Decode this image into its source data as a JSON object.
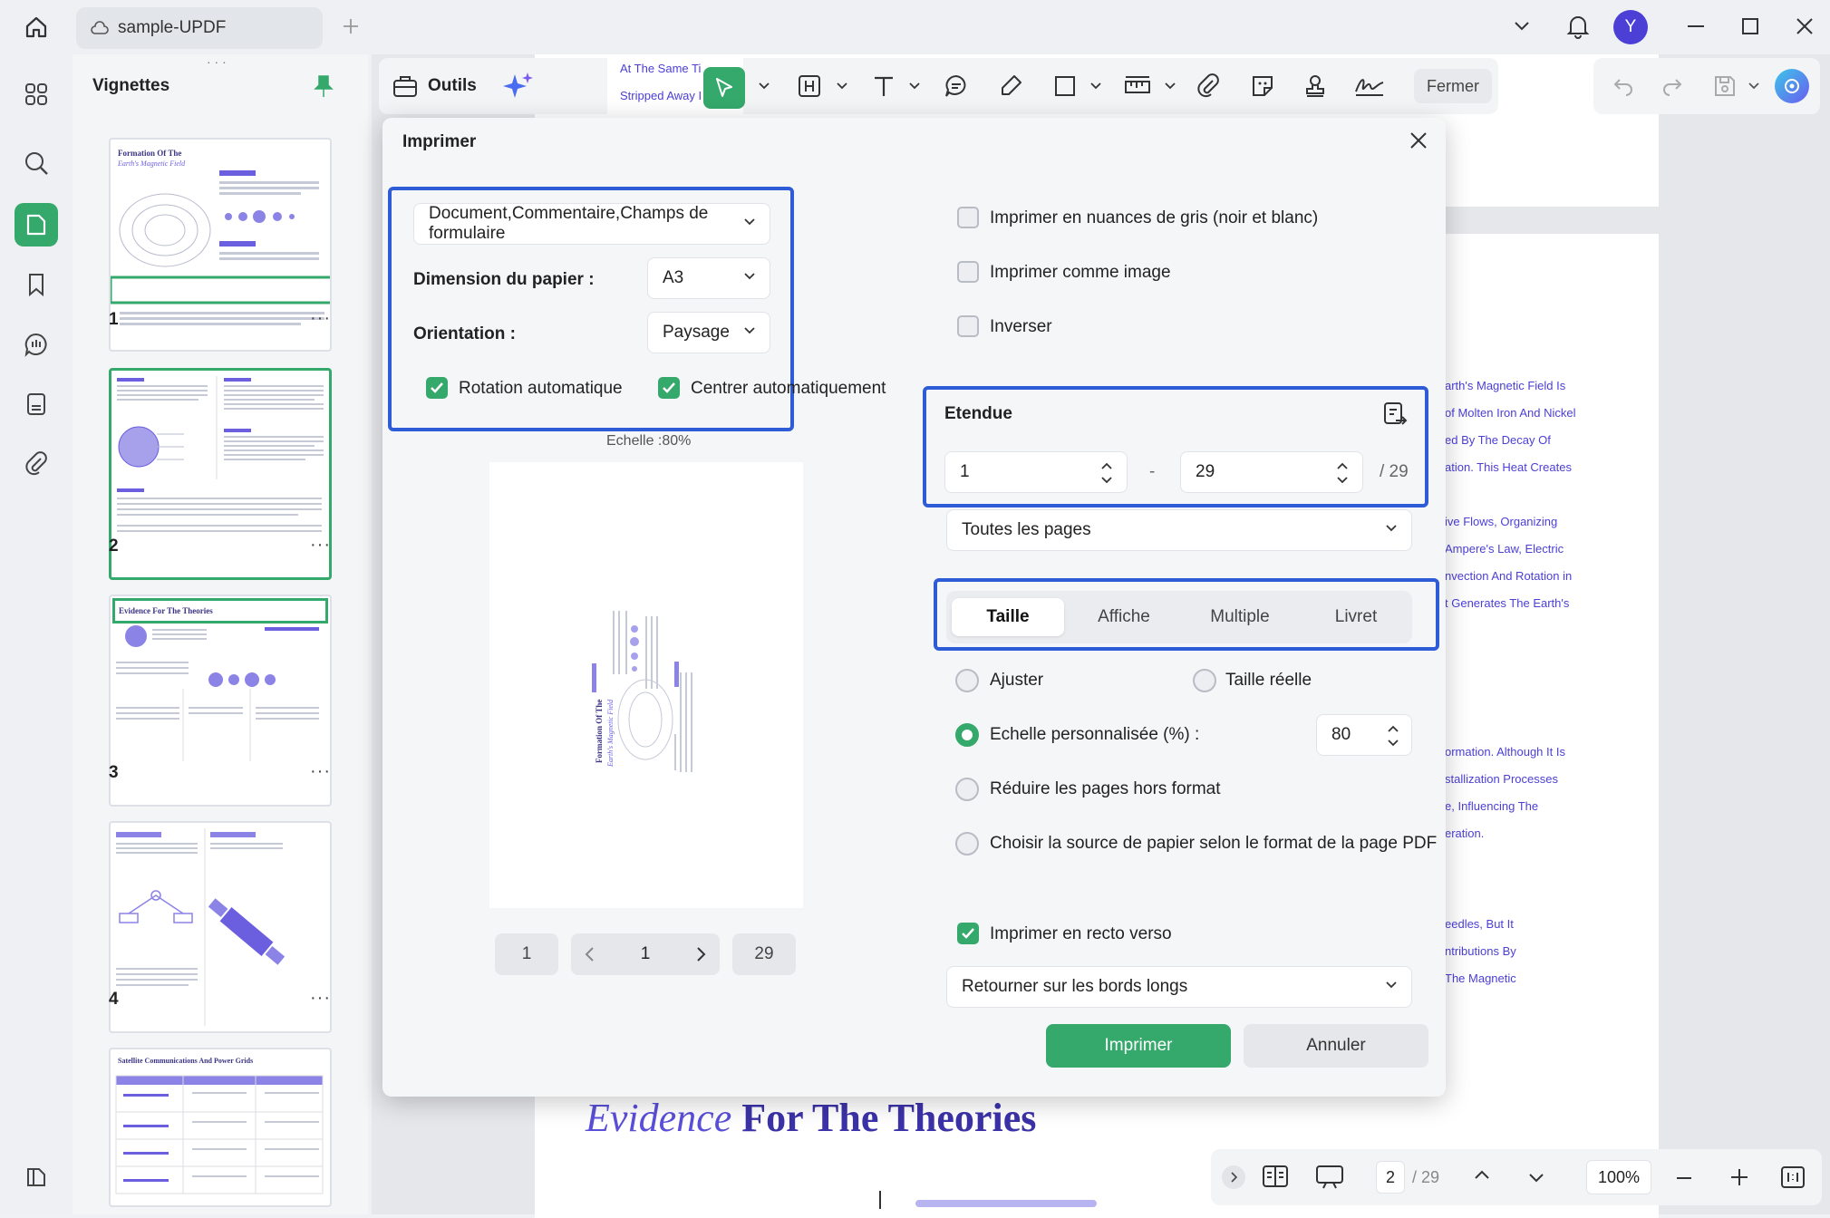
{
  "app": {
    "tab_title": "sample-UPDF",
    "avatar_initial": "Y"
  },
  "thumbnails": {
    "title": "Vignettes",
    "pages": [
      "1",
      "2",
      "3",
      "4"
    ],
    "more": "···",
    "thumb1_title": "Formation Of The",
    "thumb1_subtitle": "Earth's Magnetic Field",
    "thumb3_title": "Evidence For The Theories",
    "thumb5_title": "Satellite Communications And Power Grids"
  },
  "toolbar": {
    "tools_label": "Outils",
    "close_label": "Fermer",
    "preview_line1": "At The Same Ti",
    "preview_line2": "Stripped Away I"
  },
  "document_text": {
    "right_lines": [
      "arth's Magnetic Field Is",
      "of Molten Iron And Nickel",
      "ed By The Decay Of",
      "ation. This Heat Creates",
      "ive Flows, Organizing",
      "Ampere's Law, Electric",
      "nvection And Rotation in",
      "t Generates The Earth's",
      "ormation. Although It Is",
      "stallization Processes",
      "e, Influencing The",
      "eration.",
      "eedles, But It",
      "ntributions By",
      "The Magnetic"
    ],
    "heading_italic": "Evidence",
    "heading_rest": "For The Theories"
  },
  "dialog": {
    "title": "Imprimer",
    "content_select": "Document,Commentaire,Champs de formulaire",
    "paper_label": "Dimension du papier :",
    "paper_value": "A3",
    "orientation_label": "Orientation :",
    "orientation_value": "Paysage",
    "auto_rotate": "Rotation automatique",
    "auto_center": "Centrer automatiquement",
    "scale_caption": "Echelle :80%",
    "preview_title": "Formation Of The",
    "preview_subtitle": "Earth's Magnetic Field",
    "pager": {
      "first": "1",
      "current": "1",
      "last": "29"
    },
    "grayscale": "Imprimer en nuances de gris (noir et blanc)",
    "as_image": "Imprimer comme image",
    "invert": "Inverser",
    "range_title": "Etendue",
    "range_from": "1",
    "range_dash": "-",
    "range_to": "29",
    "range_total": "/ 29",
    "pages_select": "Toutes les pages",
    "tabs": [
      "Taille",
      "Affiche",
      "Multiple",
      "Livret"
    ],
    "fit": "Ajuster",
    "actual_size": "Taille réelle",
    "custom_scale": "Echelle personnalisée (%) :",
    "custom_scale_value": "80",
    "shrink": "Réduire les pages hors format",
    "paper_source": "Choisir la source de papier selon le format de la page PDF",
    "duplex": "Imprimer en recto verso",
    "flip_select": "Retourner sur les bords longs",
    "print_button": "Imprimer",
    "cancel_button": "Annuler"
  },
  "bottombar": {
    "page_current": "2",
    "page_total": "/ 29",
    "zoom": "100%"
  },
  "colors": {
    "accent_green": "#35a86b",
    "highlight_blue": "#2e5bd6",
    "doc_purple": "#4b3fd6"
  }
}
